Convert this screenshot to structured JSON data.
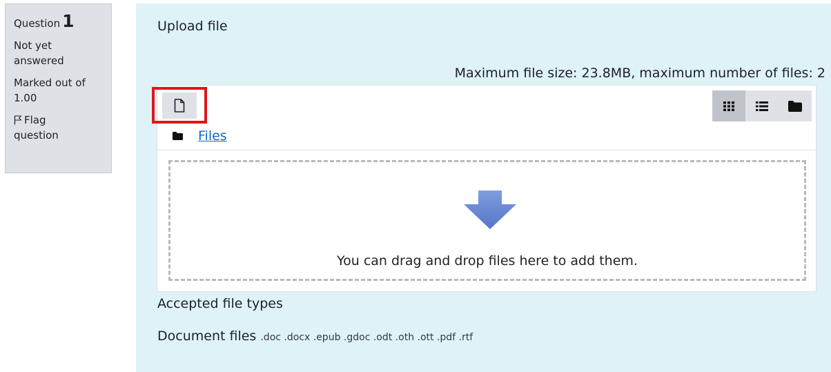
{
  "question_info": {
    "label": "Question",
    "number": "1",
    "state": "Not yet answered",
    "grade": "Marked out of 1.00",
    "flag_label": "Flag question"
  },
  "question": {
    "text": "Upload file"
  },
  "filemanager": {
    "limits": "Maximum file size: 23.8MB, maximum number of files: 2",
    "breadcrumb": "Files",
    "drop_message": "You can drag and drop files here to add them.",
    "add_button_icon": "file-add-icon",
    "view_modes": [
      {
        "icon": "grid-icon",
        "active": true
      },
      {
        "icon": "list-icon",
        "active": false
      },
      {
        "icon": "folder-icon",
        "active": false
      }
    ],
    "highlight_color": "#e0161b",
    "arrow_color": "#6a8ad6"
  },
  "accepted": {
    "title": "Accepted file types",
    "type_label": "Document files",
    "extensions": ".doc .docx .epub .gdoc .odt .oth .ott .pdf .rtf"
  },
  "colors": {
    "content_bg": "#def2f8",
    "info_bg": "#dee2e6",
    "link": "#0f6cbf"
  }
}
